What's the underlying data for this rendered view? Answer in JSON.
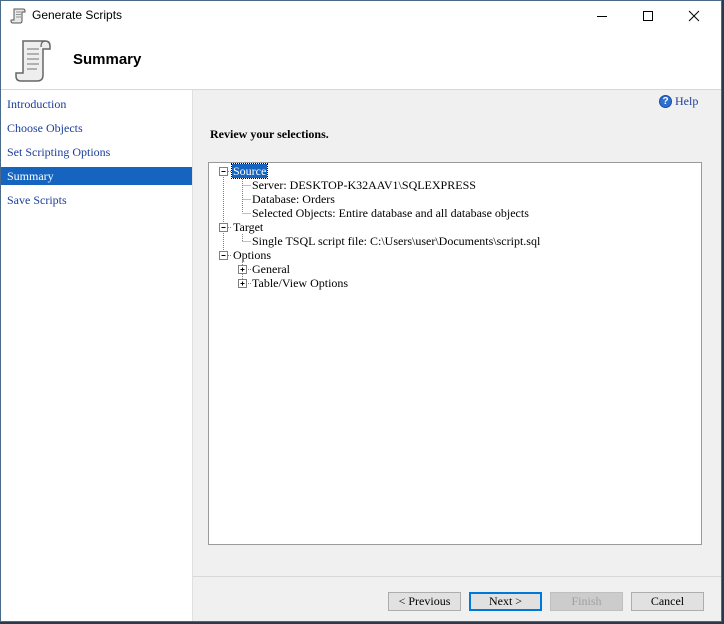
{
  "window": {
    "title": "Generate Scripts"
  },
  "header": {
    "page_title": "Summary"
  },
  "sidebar": {
    "items": [
      {
        "label": "Introduction",
        "active": false
      },
      {
        "label": "Choose Objects",
        "active": false
      },
      {
        "label": "Set Scripting Options",
        "active": false
      },
      {
        "label": "Summary",
        "active": true
      },
      {
        "label": "Save Scripts",
        "active": false
      }
    ]
  },
  "help": {
    "label": "Help"
  },
  "main": {
    "review_heading": "Review your selections.",
    "tree": {
      "source": {
        "label": "Source",
        "children": [
          "Server: DESKTOP-K32AAV1\\SQLEXPRESS",
          "Database: Orders",
          "Selected Objects: Entire database and all database objects"
        ]
      },
      "target": {
        "label": "Target",
        "children": [
          "Single TSQL script file: C:\\Users\\user\\Documents\\script.sql"
        ]
      },
      "options": {
        "label": "Options",
        "children": [
          "General",
          "Table/View Options"
        ]
      }
    }
  },
  "buttons": {
    "previous": "< Previous",
    "next": "Next >",
    "finish": "Finish",
    "cancel": "Cancel"
  },
  "icons": {
    "app": "scroll-icon",
    "header": "scroll-icon",
    "help": "help-icon"
  },
  "colors": {
    "accent": "#1565c0",
    "link": "#1a3d9a"
  }
}
